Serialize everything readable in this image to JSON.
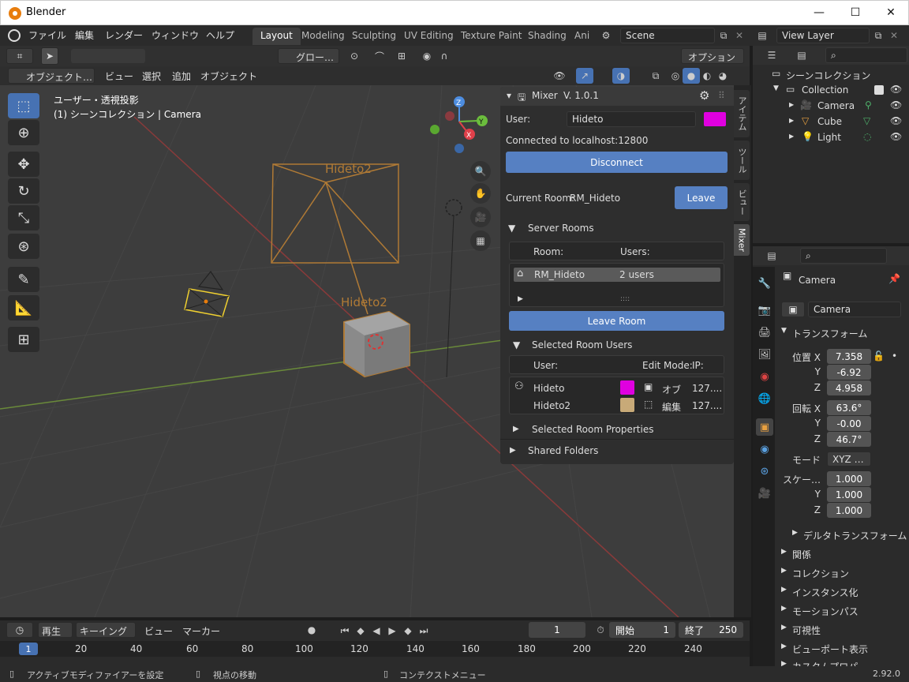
{
  "window": {
    "title": "Blender",
    "minimize": "—",
    "maximize": "☐",
    "close": "✕"
  },
  "menu": [
    "ファイル",
    "編集",
    "レンダー",
    "ウィンドウ",
    "ヘルプ"
  ],
  "workspaces": [
    "Layout",
    "Modeling",
    "Sculpting",
    "UV Editing",
    "Texture Paint",
    "Shading",
    "Ani"
  ],
  "scene": "Scene",
  "view_layer": "View Layer",
  "header2": {
    "transform": "グロー…",
    "options": "オプション"
  },
  "header3": {
    "mode": "オブジェクト…",
    "items": [
      "ビュー",
      "選択",
      "追加",
      "オブジェクト"
    ]
  },
  "viewport": {
    "overlay_line1": "ユーザー・透視投影",
    "overlay_line2": "(1) シーンコレクション | Camera",
    "label1": "Hideto2",
    "label2": "Hideto2",
    "axis_x": "X",
    "axis_y": "Y",
    "axis_z": "Z"
  },
  "ntabs": [
    "アイテム",
    "ツール",
    "ビュー",
    "Mixer"
  ],
  "mixer": {
    "title": "Mixer",
    "version": "V. 1.0.1",
    "user_label": "User:",
    "user_value": "Hideto",
    "user_color": "#e000e0",
    "connected_text": "Connected to  localhost:12800",
    "disconnect": "Disconnect",
    "current_room_label": "Current Room:",
    "current_room": "RM_Hideto",
    "leave": "Leave",
    "server_rooms": "Server Rooms",
    "room_col": "Room:",
    "users_col": "Users:",
    "rooms": [
      {
        "name": "RM_Hideto",
        "users": "2 users"
      }
    ],
    "grip": "::::",
    "leave_room": "Leave Room",
    "selected_room_users": "Selected Room Users",
    "user_col": "User:",
    "edit_mode_col": "Edit Mode:",
    "ip_col": "IP:",
    "users": [
      {
        "name": "Hideto",
        "color": "#e000e0",
        "mode": "オブ",
        "ip": "127...."
      },
      {
        "name": "Hideto2",
        "color": "#c8aa78",
        "mode": "編集",
        "ip": "127...."
      }
    ],
    "selected_room_properties": "Selected Room Properties",
    "shared_folders": "Shared Folders"
  },
  "outliner": {
    "scene_collection": "シーンコレクション",
    "items": [
      {
        "name": "Collection",
        "level": 1
      },
      {
        "name": "Camera",
        "level": 2
      },
      {
        "name": "Cube",
        "level": 2
      },
      {
        "name": "Light",
        "level": 2
      }
    ]
  },
  "properties": {
    "object_name": "Camera",
    "data_name": "Camera",
    "transform": "トランスフォーム",
    "location_label": "位置 X",
    "rotation_label": "回転 X",
    "mode_label": "モード",
    "scale_label": "スケー…",
    "axis_y": "Y",
    "axis_z": "Z",
    "location": [
      "7.358",
      "-6.92",
      "4.958"
    ],
    "rotation": [
      "63.6°",
      "-0.00",
      "46.7°"
    ],
    "mode": "XYZ …",
    "scale": [
      "1.000",
      "1.000",
      "1.000"
    ],
    "delta": "デルタトランスフォーム",
    "sections": [
      "関係",
      "コレクション",
      "インスタンス化",
      "モーションパス",
      "可視性",
      "ビューポート表示",
      "カスタムプロパ…"
    ]
  },
  "timeline": {
    "playback": "再生",
    "keying": "キーイング",
    "view": "ビュー",
    "marker": "マーカー",
    "current_frame": "1",
    "start_label": "開始",
    "start": "1",
    "end_label": "終了",
    "end": "250",
    "frame_indicator": "1",
    "ruler": [
      "20",
      "40",
      "60",
      "80",
      "100",
      "120",
      "140",
      "160",
      "180",
      "200",
      "220",
      "240"
    ]
  },
  "status": {
    "left": "アクティブモディファイアーを設定",
    "mid": "視点の移動",
    "right": "コンテクストメニュー",
    "version": "2.92.0"
  }
}
